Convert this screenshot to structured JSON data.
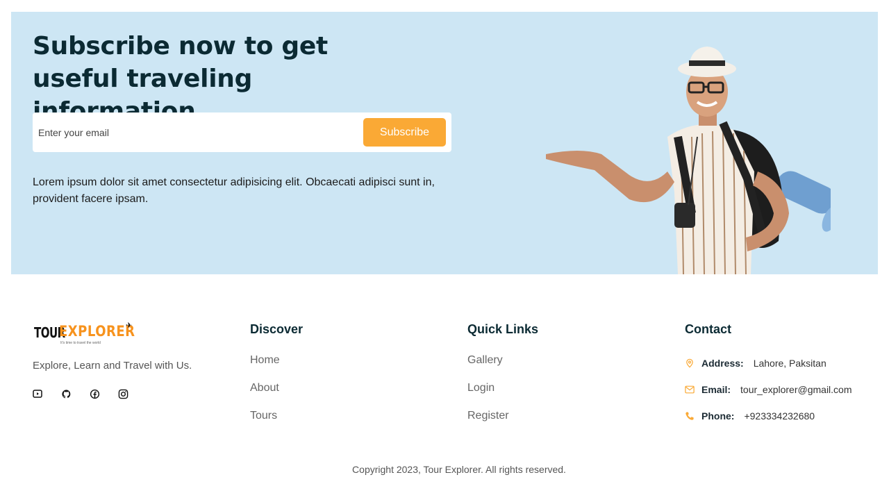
{
  "banner": {
    "title": "Subscribe now to get useful traveling information.",
    "email_placeholder": "Enter your email",
    "subscribe_label": "Subscribe",
    "description": "Lorem ipsum dolor sit amet consectetur adipisicing elit. Obcaecati adipisci sunt in, provident facere ipsam."
  },
  "logo": {
    "tour": "TOUR",
    "explorer": "EXPLORER",
    "tagline": "It's time to travel the world"
  },
  "about": {
    "text": "Explore, Learn and Travel with Us.",
    "social": [
      "youtube-icon",
      "github-icon",
      "facebook-icon",
      "instagram-icon"
    ]
  },
  "discover": {
    "heading": "Discover",
    "items": [
      "Home",
      "About",
      "Tours"
    ]
  },
  "quick_links": {
    "heading": "Quick Links",
    "items": [
      "Gallery",
      "Login",
      "Register"
    ]
  },
  "contact": {
    "heading": "Contact",
    "address_label": "Address:",
    "address_value": "Lahore, Paksitan",
    "email_label": "Email:",
    "email_value": "tour_explorer@gmail.com",
    "phone_label": "Phone:",
    "phone_value": "+923334232680"
  },
  "copyright": "Copyright 2023, Tour Explorer. All rights reserved.",
  "colors": {
    "accent": "#faa935",
    "banner_bg": "#cde6f4",
    "heading": "#0b2a33"
  }
}
